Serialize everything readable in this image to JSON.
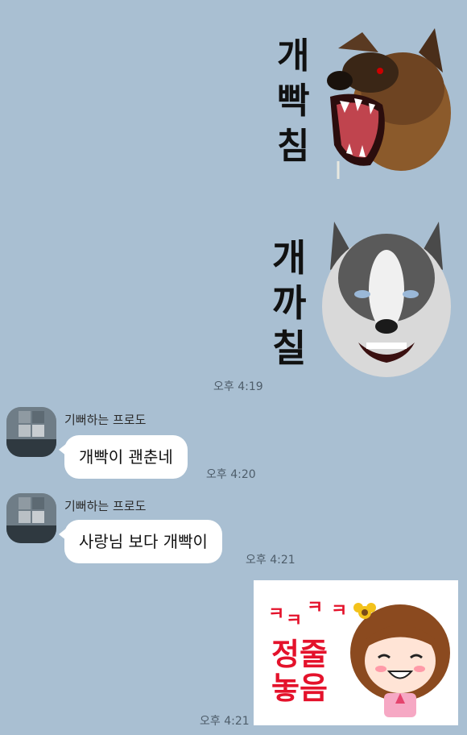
{
  "stickers": {
    "sticker1": {
      "lines": [
        "개",
        "빡",
        "침"
      ],
      "image": "angry-german-shepherd"
    },
    "sticker2": {
      "lines": [
        "개",
        "까",
        "칠"
      ],
      "image": "snarling-husky"
    },
    "sticker3": {
      "laugh": [
        "ㅋ",
        "ㅋ",
        "ㅋ",
        "ㅋ"
      ],
      "lines": [
        "정줄",
        "놓음"
      ],
      "image": "laughing-cartoon-girl"
    }
  },
  "messages": [
    {
      "time": "오후 4:19"
    },
    {
      "sender": "기뻐하는 프로도",
      "text": "개빡이 괜춘네",
      "time": "오후 4:20"
    },
    {
      "sender": "기뻐하는 프로도",
      "text": "사랑님 보다 개빡이",
      "time": "오후 4:21"
    },
    {
      "time": "오후 4:21"
    }
  ],
  "colors": {
    "background": "#a9bfd2",
    "bubble": "#ffffff",
    "laugh": "#e4122b"
  }
}
